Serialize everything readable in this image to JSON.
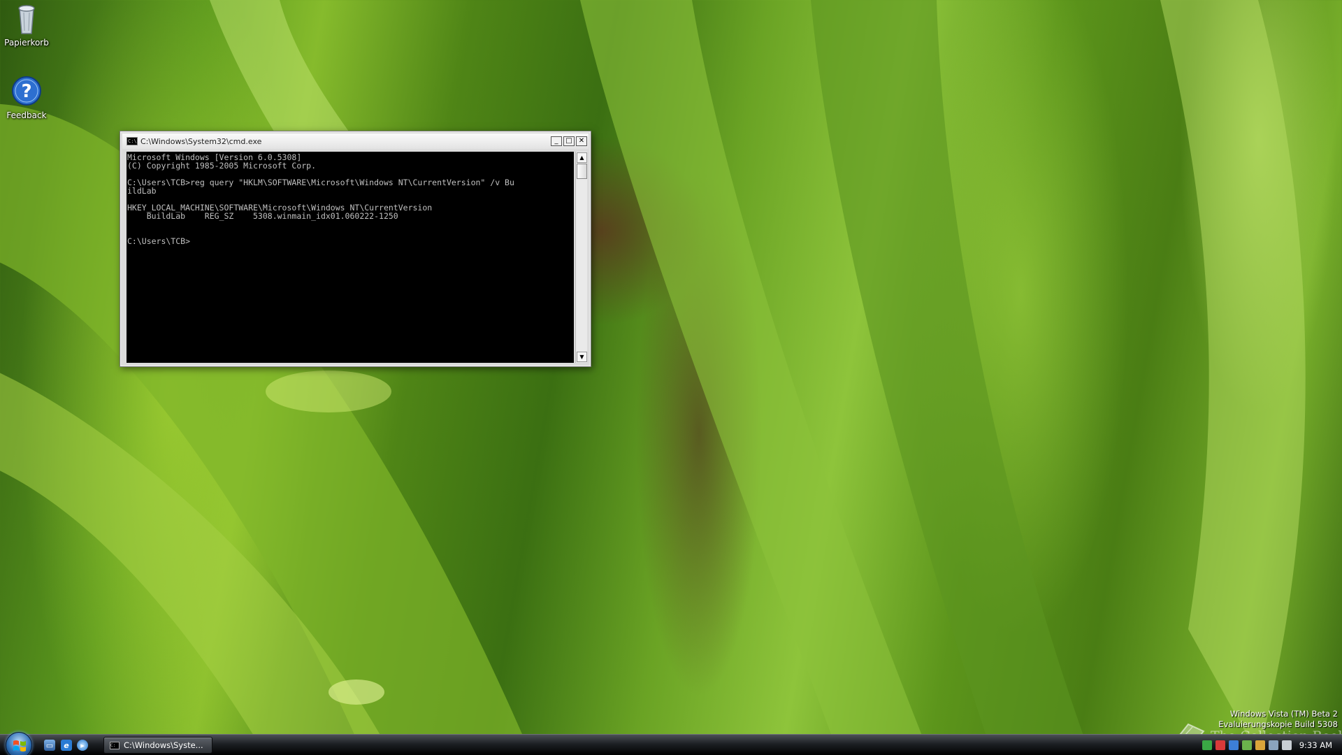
{
  "desktop": {
    "icons": [
      {
        "label": "Papierkorb",
        "icon": "recycle-bin-icon"
      },
      {
        "label": "Feedback",
        "icon": "help-feedback-icon"
      }
    ]
  },
  "cmd": {
    "title": "C:\\Windows\\System32\\cmd.exe",
    "lines": [
      "Microsoft Windows [Version 6.0.5308]",
      "(C) Copyright 1985-2005 Microsoft Corp.",
      "",
      "C:\\Users\\TCB>reg query \"HKLM\\SOFTWARE\\Microsoft\\Windows NT\\CurrentVersion\" /v Bu",
      "ildLab",
      "",
      "HKEY_LOCAL_MACHINE\\SOFTWARE\\Microsoft\\Windows NT\\CurrentVersion",
      "    BuildLab    REG_SZ    5308.winmain_idx01.060222-1250",
      "",
      "",
      "C:\\Users\\TCB>"
    ]
  },
  "build_info": {
    "line1": "Windows Vista (TM) Beta 2",
    "line2": "Evaluierungskopie Build 5308"
  },
  "watermark": {
    "text": "The Collection Book"
  },
  "taskbar": {
    "task_label": "C:\\Windows\\Syste...",
    "clock": "9:33 AM"
  }
}
